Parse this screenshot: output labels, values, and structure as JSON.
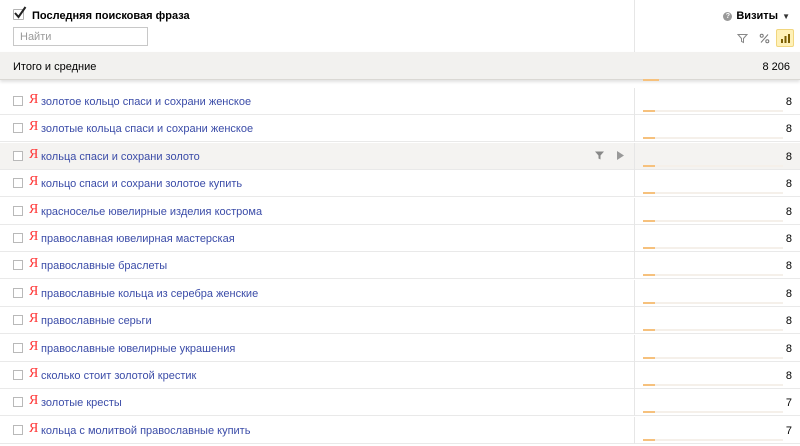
{
  "header": {
    "title": "Последняя поисковая фраза",
    "search_placeholder": "Найти",
    "metric_label": "Визиты",
    "help_icon": "question-icon",
    "caret": "▼"
  },
  "totals": {
    "label": "Итого и средние",
    "value": "8 206"
  },
  "rows": [
    {
      "phrase": "золотое кольцо спаси и сохрани женское",
      "value": "8"
    },
    {
      "phrase": "золотые кольца спаси и сохрани женское",
      "value": "8"
    },
    {
      "phrase": "кольца спаси и сохрани золото",
      "value": "8"
    },
    {
      "phrase": "кольцо спаси и сохрани золотое купить",
      "value": "8"
    },
    {
      "phrase": "красноселье ювелирные изделия кострома",
      "value": "8"
    },
    {
      "phrase": "православная ювелирная мастерская",
      "value": "8"
    },
    {
      "phrase": "православные браслеты",
      "value": "8"
    },
    {
      "phrase": "православные кольца из серебра женские",
      "value": "8"
    },
    {
      "phrase": "православные серьги",
      "value": "8"
    },
    {
      "phrase": "православные ювелирные украшения",
      "value": "8"
    },
    {
      "phrase": "сколько стоит золотой крестик",
      "value": "8"
    },
    {
      "phrase": "золотые кресты",
      "value": "7"
    },
    {
      "phrase": "кольца с молитвой православные купить",
      "value": "7"
    }
  ],
  "yandex_glyph": "Я",
  "colors": {
    "link": "#3b4ca8",
    "yandex": "#ff3333",
    "bar": "#f6c17d",
    "active_tool": "#fff1b8"
  }
}
